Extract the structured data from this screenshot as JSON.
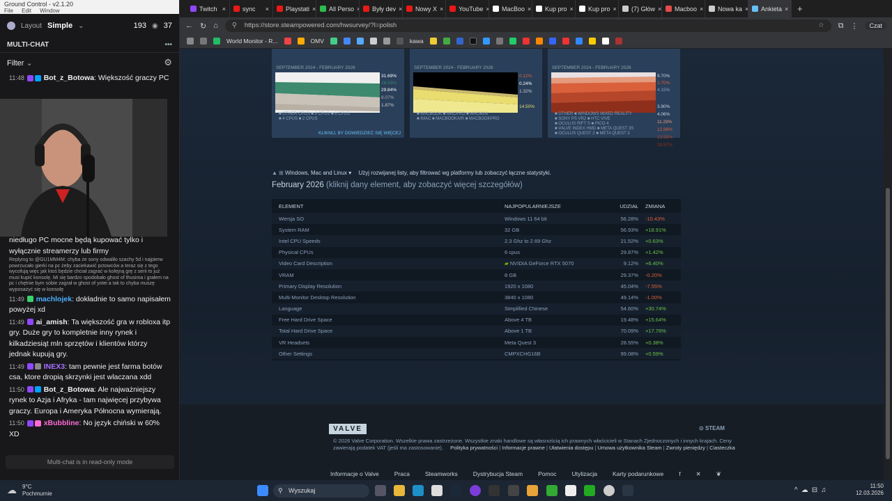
{
  "left": {
    "app_title": "Ground Control - v2.1.20",
    "menu": [
      "File",
      "Edit",
      "Window"
    ],
    "layout_label": "Layout",
    "layout_value": "Simple",
    "viewers": "193",
    "viewers2": "37",
    "multichat_title": "MULTI-CHAT",
    "filter_label": "Filter",
    "readonly": "Multi-chat is in read-only mode",
    "messages": [
      {
        "time": "11:48",
        "user": "Bot_z_Botowa",
        "color": "#ffffff",
        "text": "Większość graczy PC"
      },
      {
        "time": "",
        "user": "",
        "color": "#ffffff",
        "text": "niedługo PC mocne będą kupować tylko i wyłącznie streamerzy lub firmy"
      },
      {
        "time": "11:49",
        "user": "machlojek",
        "color": "#4ab0ff",
        "text": "dokładnie to samo napisałem powyżej xd"
      },
      {
        "time": "11:49",
        "user": "ai_amish",
        "color": "#ffffff",
        "text": "Ta większość gra w robloxa itp gry. Duże gry to kompletnie inny rynek i kilkadziesiąt mln sprzętów i klientów którzy jednak kupują gry."
      },
      {
        "time": "11:49",
        "user": "INEX3",
        "color": "#a970ff",
        "text": "tam pewnie jest farma botów csa, ktore dropią skrzynki jest wlaczana xdd"
      },
      {
        "time": "11:50",
        "user": "Bot_z_Botowa",
        "color": "#ffffff",
        "text": "Ale najważniejszy rynek to Azja i Afryka - tam najwięcej przybywa graczy. Europa i Ameryka Północna wymierają."
      },
      {
        "time": "11:50",
        "user": "xBubbline",
        "color": "#ff6bd5",
        "text": "No język chiński w 60% XD"
      }
    ],
    "reply": "Replying to @GU1MM4M: chyba że sony odwaliło szachy 5d i najpierw powrzucało gierki na pc żeby zaciekawić pctowców a teraz się z tego wycofują więc jak ktoś będzie chciał zagrać w kolejną grę z serii to już musi kupić konsolę. Mi się bardzo spodobało ghost of thusima i grałem na pc i chętnie bym sobie zagrał w ghost of yotei a tak to chyba muszę wyposażyć się w konsolę"
  },
  "browser": {
    "tabs": [
      {
        "label": "Twitch",
        "color": "#9147ff"
      },
      {
        "label": "sync",
        "color": "#e91916"
      },
      {
        "label": "Playstati",
        "color": "#e91916"
      },
      {
        "label": "All Perso",
        "color": "#2dbb4f"
      },
      {
        "label": "Były dev",
        "color": "#e91916"
      },
      {
        "label": "Nowy X",
        "color": "#e91916"
      },
      {
        "label": "YouTube",
        "color": "#e91916"
      },
      {
        "label": "MacBoo",
        "color": "#ffffff"
      },
      {
        "label": "Kup pro",
        "color": "#ffffff"
      },
      {
        "label": "Kup pro",
        "color": "#ffffff"
      },
      {
        "label": "(7) Głów",
        "color": "#cccccc"
      },
      {
        "label": "Macboo",
        "color": "#e54b4b"
      },
      {
        "label": "Nowa ka",
        "color": "#cccccc"
      },
      {
        "label": "Ankieta",
        "color": "#66c0f4"
      }
    ],
    "url": "https://store.steampowered.com/hwsurvey/?l=polish",
    "bookmark_text": [
      "World Monitor - R...",
      "OMV",
      "kawa"
    ],
    "profile_label": "Czat"
  },
  "survey": {
    "panels": [
      {
        "period": "SEPTEMBER 2024 - FEBRUARY 2026",
        "pcts": [
          "31.69%",
          "28.53%",
          "29.84%",
          "8.07%",
          "1.87%"
        ],
        "legend": [
          "OTHER CPUS",
          "8 CPUS",
          "6 CPUS",
          "4 CPUS",
          "2 CPUS"
        ],
        "more": "KLIKNIJ, BY DOWIEDZIEĆ SIĘ WIĘCEJ"
      },
      {
        "period": "SEPTEMBER 2024 - FEBRUARY 2026",
        "pcts": [
          "0.12%",
          "0.24%",
          "1.32%",
          "14.50%"
        ],
        "legend": [
          "MACBOOK",
          "MACPRO",
          "MACMINI",
          "IMAC",
          "MACBOOKAIR",
          "MACBOOKPRO"
        ],
        "more": ""
      },
      {
        "period": "SEPTEMBER 2024 - FEBRUARY 2026",
        "pcts": [
          "9.70%",
          "2.70%",
          "4.15%",
          "3.90%",
          "4.06%",
          "11.29%",
          "12.88%",
          "23.55%",
          "28.57%"
        ],
        "legend": [
          "OTHER",
          "WINDOWS MIXED REALITY",
          "SONY PS VR2",
          "HTC VIVE",
          "OCULUS RIFT S",
          "PICO 4",
          "VALVE INDEX HMD",
          "META QUEST 3S",
          "OCULUS QUEST 2",
          "META QUEST 3"
        ],
        "more": ""
      }
    ],
    "platform_filter": "Windows, Mac and Linux ▾",
    "platform_hint": "Użyj rozwijanej listy, aby filtrować wg platformy lub zobaczyć łączne statystyki.",
    "title_month": "February 2026",
    "title_hint": "(kliknij dany element, aby zobaczyć więcej szczegółów)",
    "columns": [
      "ELEMENT",
      "NAJPOPULARNIEJSZE",
      "UDZIAŁ",
      "ZMIANA"
    ],
    "rows": [
      [
        "Wersja SO",
        "Windows 11 64 bit",
        "56.28%",
        "-10.43%"
      ],
      [
        "System RAM",
        "32 GB",
        "56.93%",
        "+18.91%"
      ],
      [
        "Intel CPU Speeds",
        "2.3 Ghz to 2.69 Ghz",
        "21.52%",
        "+0.63%"
      ],
      [
        "Physical CPUs",
        "6 cpus",
        "29.87%",
        "+1.42%"
      ],
      [
        "Video Card Description",
        "NVIDIA GeForce RTX 5070",
        "9.12%",
        "+6.40%"
      ],
      [
        "VRAM",
        "8 GB",
        "29.37%",
        "-0.20%"
      ],
      [
        "Primary Display Resolution",
        "1920 x 1080",
        "45.04%",
        "-7.55%"
      ],
      [
        "Multi-Monitor Desktop Resolution",
        "3840 x 1080",
        "49.14%",
        "-1.00%"
      ],
      [
        "Language",
        "Simplified Chinese",
        "54.60%",
        "+30.74%"
      ],
      [
        "Free Hard Drive Space",
        "Above 4 TB",
        "19.48%",
        "+15.64%"
      ],
      [
        "Total Hard Drive Space",
        "Above 1 TB",
        "70.09%",
        "+17.76%"
      ],
      [
        "VR Headsets",
        "Meta Quest 3",
        "28.55%",
        "+0.38%"
      ],
      [
        "Other Settings",
        "CMPXCHG16B",
        "99.08%",
        "+0.59%"
      ]
    ]
  },
  "footer": {
    "valve": "VALVE",
    "steam": "STEAM",
    "legal": "© 2026 Valve Corporation. Wszelkie prawa zastrzeżone. Wszystkie znaki handlowe są własnością ich prawnych właścicieli w Stanach Zjednoczonych i innych krajach. Ceny zawierają podatek VAT (jeśli ma zastosowanie).",
    "legal_links": [
      "Polityka prywatności",
      "Informacje prawne",
      "Ułatwienia dostępu",
      "Umowa użytkownika Steam",
      "Zwroty pieniędzy",
      "Ciasteczka"
    ],
    "links": [
      "Informacje o Valve",
      "Praca",
      "Steamworks",
      "Dystrybucja Steam",
      "Pomoc",
      "Utylizacja",
      "Karty podarunkowe"
    ]
  },
  "taskbar": {
    "temp": "9°C",
    "weather": "Pochmurnie",
    "search": "Wyszukaj",
    "time": "11:50",
    "date": "12.03.2026"
  }
}
